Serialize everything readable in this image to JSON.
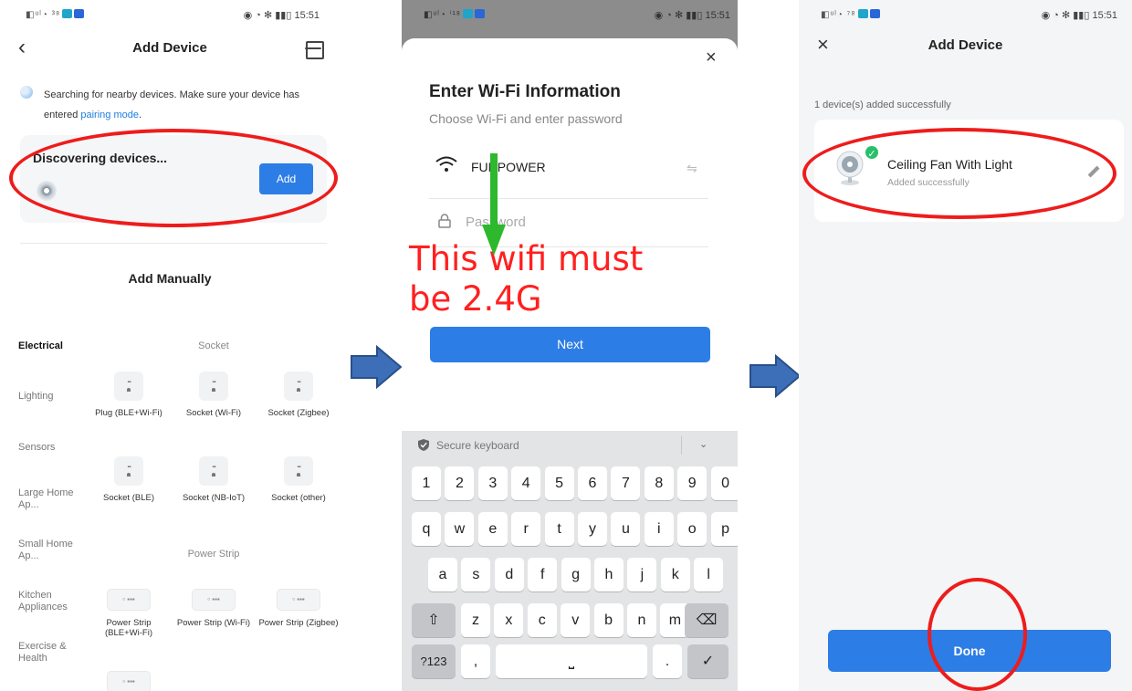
{
  "screen1": {
    "status_left": "◧ᵘˡ◔ ³⁸",
    "status_right": "◉ ◔ ✻ ▮▮▯ 15:51",
    "title": "Add Device",
    "search_text_pre": "Searching for nearby devices. Make sure your device has entered ",
    "search_link": "pairing mode",
    "search_text_post": ".",
    "discovering": "Discovering devices...",
    "add_button": "Add",
    "add_manually": "Add Manually",
    "categories": [
      "Electrical",
      "Lighting",
      "Sensors",
      "Large Home Ap...",
      "Small Home Ap...",
      "Kitchen Appliances",
      "Exercise & Health"
    ],
    "section_socket": "Socket",
    "section_power_strip": "Power Strip",
    "tiles": {
      "plug_ble_wifi": "Plug (BLE+Wi-Fi)",
      "socket_wifi": "Socket (Wi-Fi)",
      "socket_zigbee": "Socket (Zigbee)",
      "socket_ble": "Socket (BLE)",
      "socket_nbiot": "Socket (NB-IoT)",
      "socket_other": "Socket (other)",
      "strip_ble_wifi": "Power Strip (BLE+Wi-Fi)",
      "strip_wifi": "Power Strip (Wi-Fi)",
      "strip_zigbee": "Power Strip (Zigbee)"
    }
  },
  "screen2": {
    "status_left": "◧ᵘˡ◔ ⁱ¹⁸",
    "status_right": "◉ ◔ ✻ ▮▮▯ 15:51",
    "close": "×",
    "title": "Enter Wi-Fi Information",
    "subtitle": "Choose Wi-Fi and enter password",
    "ssid": "FUNPOWER",
    "swap": "⇋",
    "password_placeholder": "Password",
    "annotation": "This wifi must be 2.4G",
    "next_button": "Next",
    "keyboard_label": "Secure keyboard",
    "keyboard_collapse": "⌄",
    "row_numbers": [
      "1",
      "2",
      "3",
      "4",
      "5",
      "6",
      "7",
      "8",
      "9",
      "0"
    ],
    "row_q": [
      "q",
      "w",
      "e",
      "r",
      "t",
      "y",
      "u",
      "i",
      "o",
      "p"
    ],
    "row_a": [
      "a",
      "s",
      "d",
      "f",
      "g",
      "h",
      "j",
      "k",
      "l"
    ],
    "row_z": [
      "z",
      "x",
      "c",
      "v",
      "b",
      "n",
      "m"
    ],
    "shift": "⇧",
    "backspace": "⌫",
    "mode": "?123",
    "comma": ",",
    "space": "⎵",
    "period": ".",
    "enter": "✓"
  },
  "screen3": {
    "status_left": "◧ᵘˡ◔ ⁷⁸",
    "status_right": "◉ ◔ ✻ ▮▮▯ 15:51",
    "close": "×",
    "title": "Add Device",
    "added_count": "1 device(s) added successfully",
    "device_name": "Ceiling Fan With Light",
    "device_status": "Added successfully",
    "done_button": "Done"
  },
  "colors": {
    "accent_blue": "#2c7de6",
    "annotation_red": "#ee1c1c",
    "success_green": "#27c06b",
    "arrow_green": "#2db82d",
    "arrow_blue": "#3d6fb8"
  }
}
